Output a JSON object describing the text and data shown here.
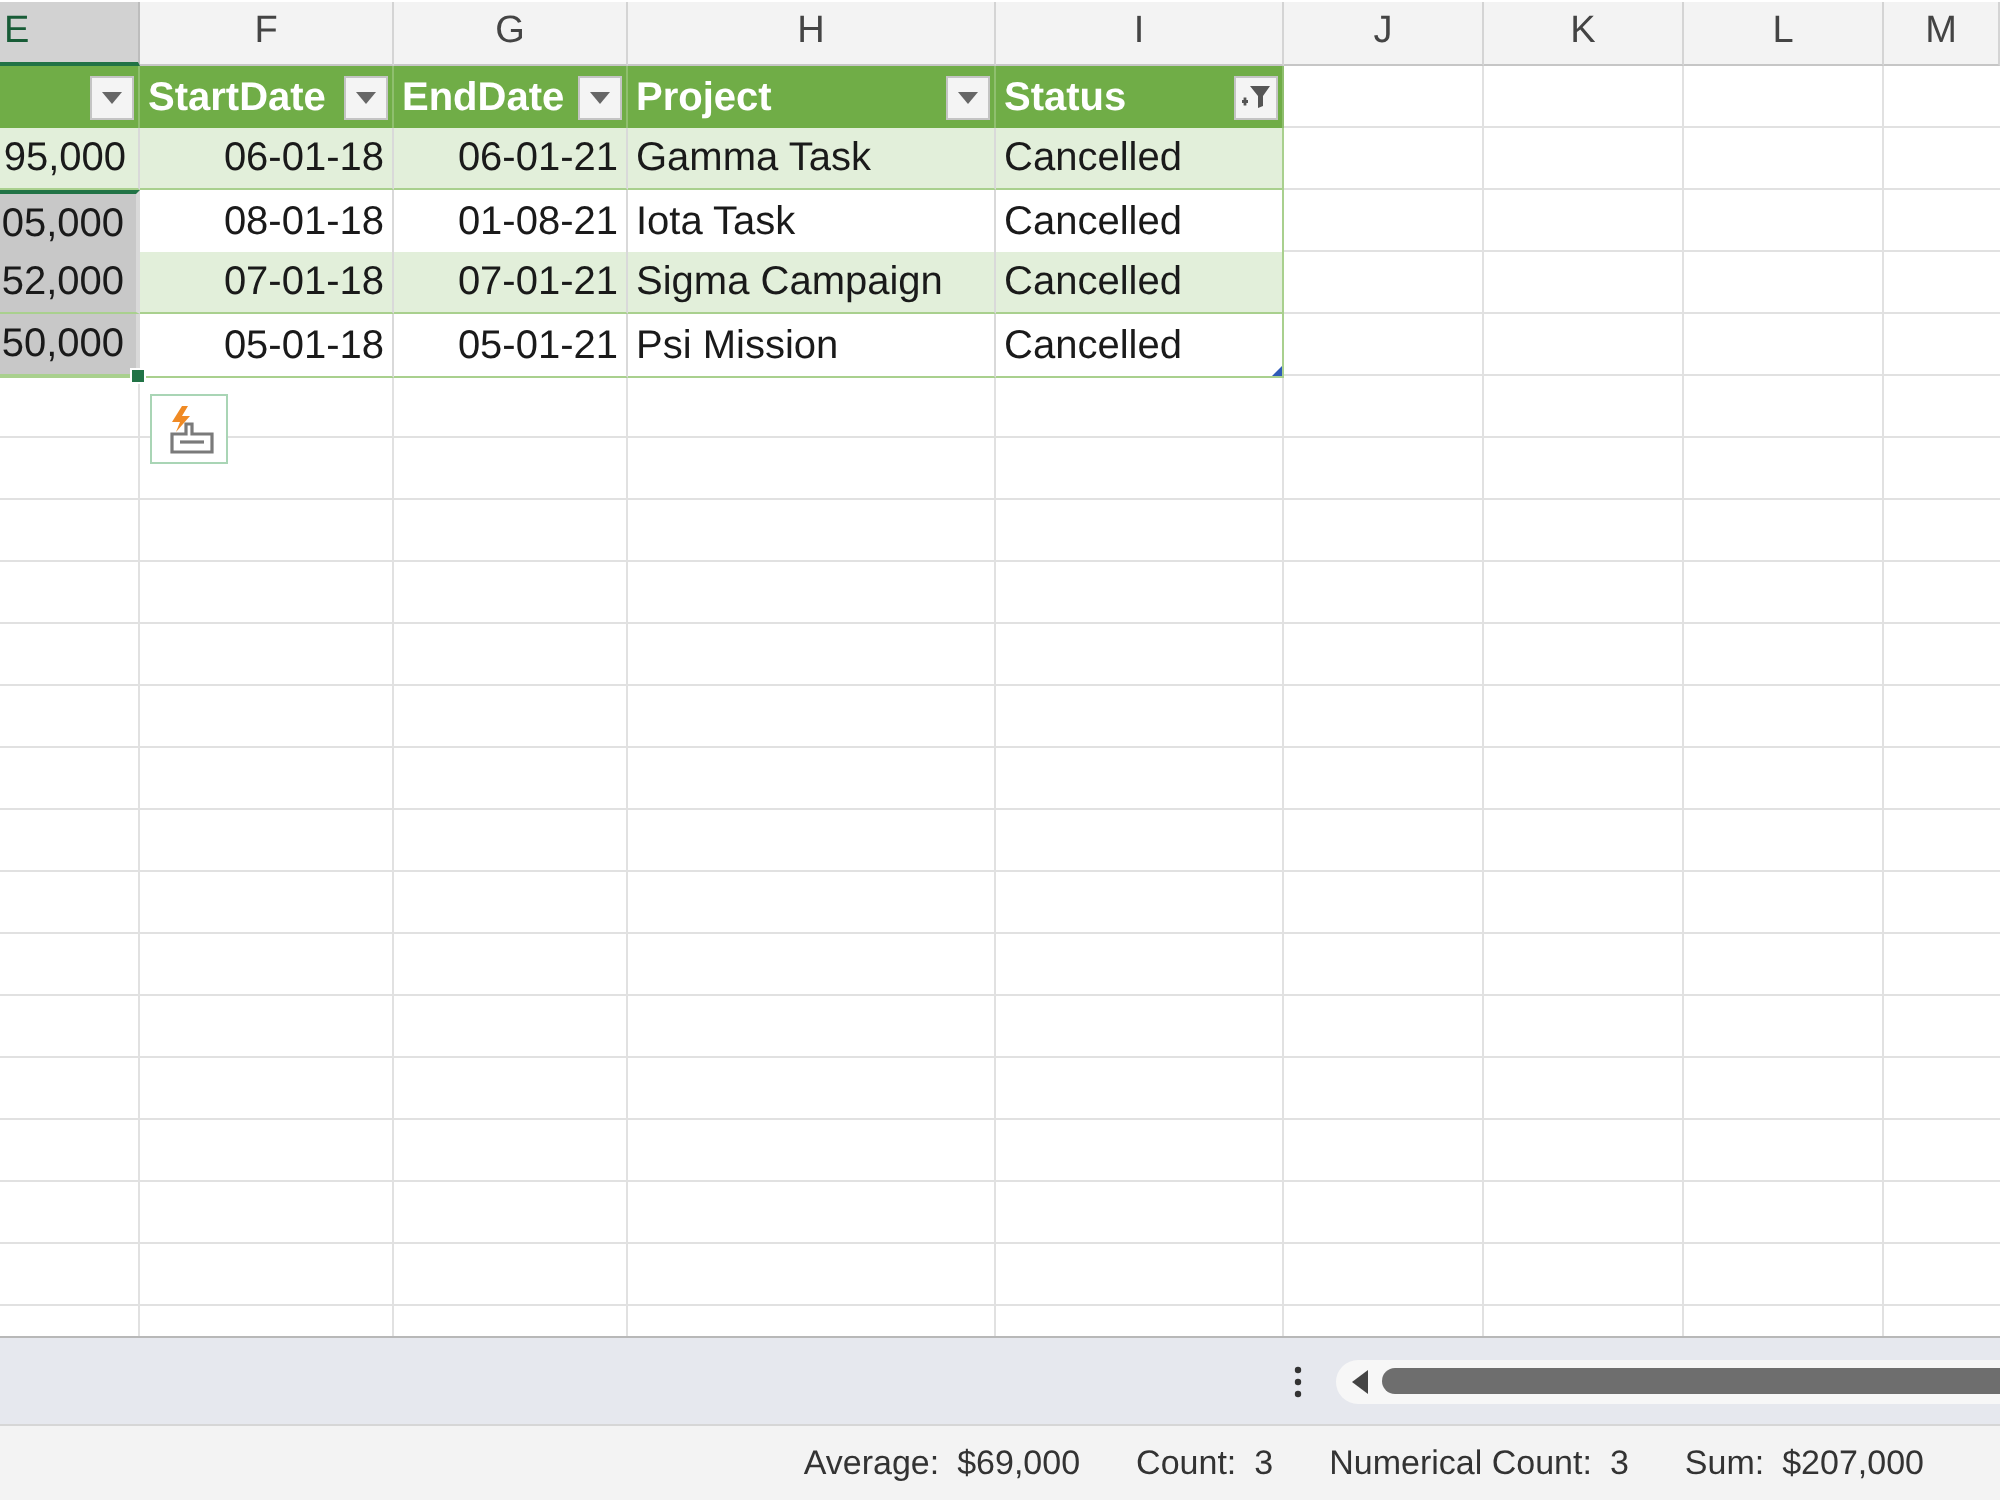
{
  "column_headers": [
    {
      "label": "E",
      "selected": true
    },
    {
      "label": "F",
      "selected": false
    },
    {
      "label": "G",
      "selected": false
    },
    {
      "label": "H",
      "selected": false
    },
    {
      "label": "I",
      "selected": false
    },
    {
      "label": "J",
      "selected": false
    },
    {
      "label": "K",
      "selected": false
    },
    {
      "label": "L",
      "selected": false
    },
    {
      "label": "M",
      "selected": false
    }
  ],
  "table": {
    "columns": [
      {
        "kind": "number",
        "filtered": false
      },
      {
        "label": "StartDate",
        "kind": "date",
        "filtered": false
      },
      {
        "label": "EndDate",
        "kind": "date",
        "filtered": false
      },
      {
        "label": "Project",
        "kind": "text",
        "filtered": false
      },
      {
        "label": "Status",
        "kind": "text",
        "filtered": true
      }
    ],
    "rows": [
      {
        "cells": [
          "95,000",
          "06-01-18",
          "06-01-21",
          "Gamma Task",
          "Cancelled"
        ],
        "selected": false
      },
      {
        "cells": [
          "05,000",
          "08-01-18",
          "01-08-21",
          "Iota Task",
          "Cancelled"
        ],
        "selected": true
      },
      {
        "cells": [
          "52,000",
          "07-01-18",
          "07-01-21",
          "Sigma Campaign",
          "Cancelled"
        ],
        "selected": true
      },
      {
        "cells": [
          "50,000",
          "05-01-18",
          "05-01-21",
          "Psi Mission",
          "Cancelled"
        ],
        "selected": true
      }
    ]
  },
  "status_bar": {
    "items": [
      {
        "label": "Average:",
        "value": "$69,000"
      },
      {
        "label": "Count:",
        "value": "3"
      },
      {
        "label": "Numerical Count:",
        "value": "3"
      },
      {
        "label": "Sum:",
        "value": "$207,000"
      }
    ]
  }
}
